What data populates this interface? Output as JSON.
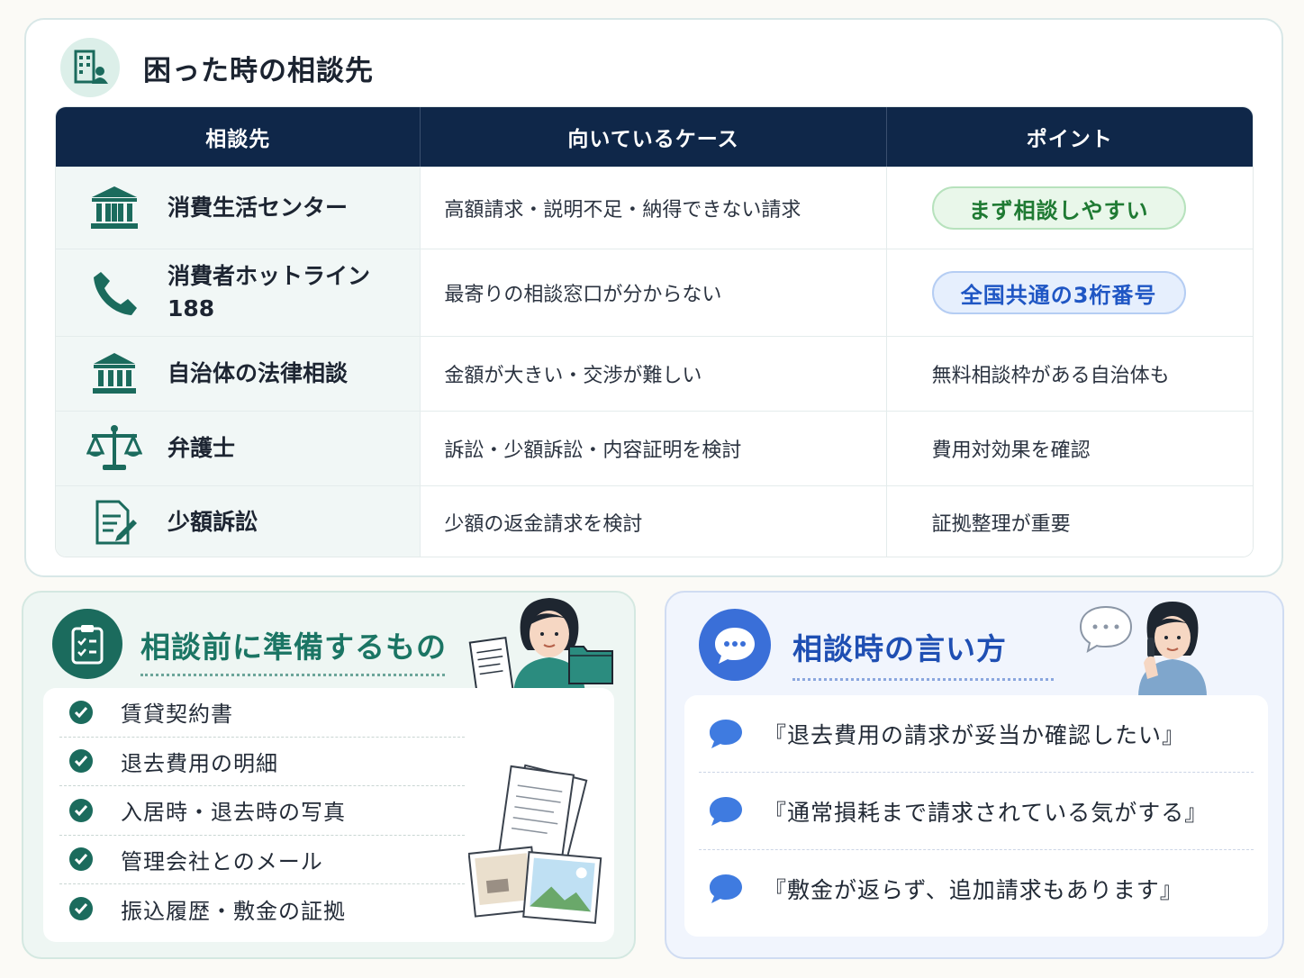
{
  "consult_section": {
    "title": "困った時の相談先",
    "icon": "office-building-person-icon",
    "columns": [
      "相談先",
      "向いているケース",
      "ポイント"
    ],
    "rows": [
      {
        "icon": "institution-building-icon",
        "name": "消費生活センター",
        "name_line2": "",
        "case": "高額請求・説明不足・納得できない請求",
        "point": "まず相談しやすい",
        "point_style": "green-pill"
      },
      {
        "icon": "phone-icon",
        "name": "消費者ホットライン",
        "name_line2": "188",
        "case": "最寄りの相談窓口が分からない",
        "point": "全国共通の3桁番号",
        "point_style": "blue-pill"
      },
      {
        "icon": "government-building-icon",
        "name": "自治体の法律相談",
        "name_line2": "",
        "case": "金額が大きい・交渉が難しい",
        "point": "無料相談枠がある自治体も",
        "point_style": "text"
      },
      {
        "icon": "scales-icon",
        "name": "弁護士",
        "name_line2": "",
        "case": "訴訟・少額訴訟・内容証明を検討",
        "point": "費用対効果を確認",
        "point_style": "text"
      },
      {
        "icon": "document-pen-icon",
        "name": "少額訴訟",
        "name_line2": "",
        "case": "少額の返金請求を検討",
        "point": "証拠整理が重要",
        "point_style": "text"
      }
    ]
  },
  "prepare_section": {
    "title": "相談前に準備するもの",
    "icon": "clipboard-checklist-icon",
    "items": [
      "賃貸契約書",
      "退去費用の明細",
      "入居時・退去時の写真",
      "管理会社とのメール",
      "振込履歴・敷金の証拠"
    ]
  },
  "phrases_section": {
    "title": "相談時の言い方",
    "icon": "chat-bubble-icon",
    "items": [
      "『退去費用の請求が妥当か確認したい』",
      "『通常損耗まで請求されている気がする』",
      "『敷金が返らず、追加請求もあります』"
    ]
  },
  "colors": {
    "navy_header": "#0f2749",
    "teal": "#1b6b5d",
    "teal_title": "#1b7564",
    "blue": "#3a6fd8",
    "blue_title": "#1f4fb3",
    "green_pill": "#1f7a33",
    "blue_pill": "#1f56c4"
  }
}
